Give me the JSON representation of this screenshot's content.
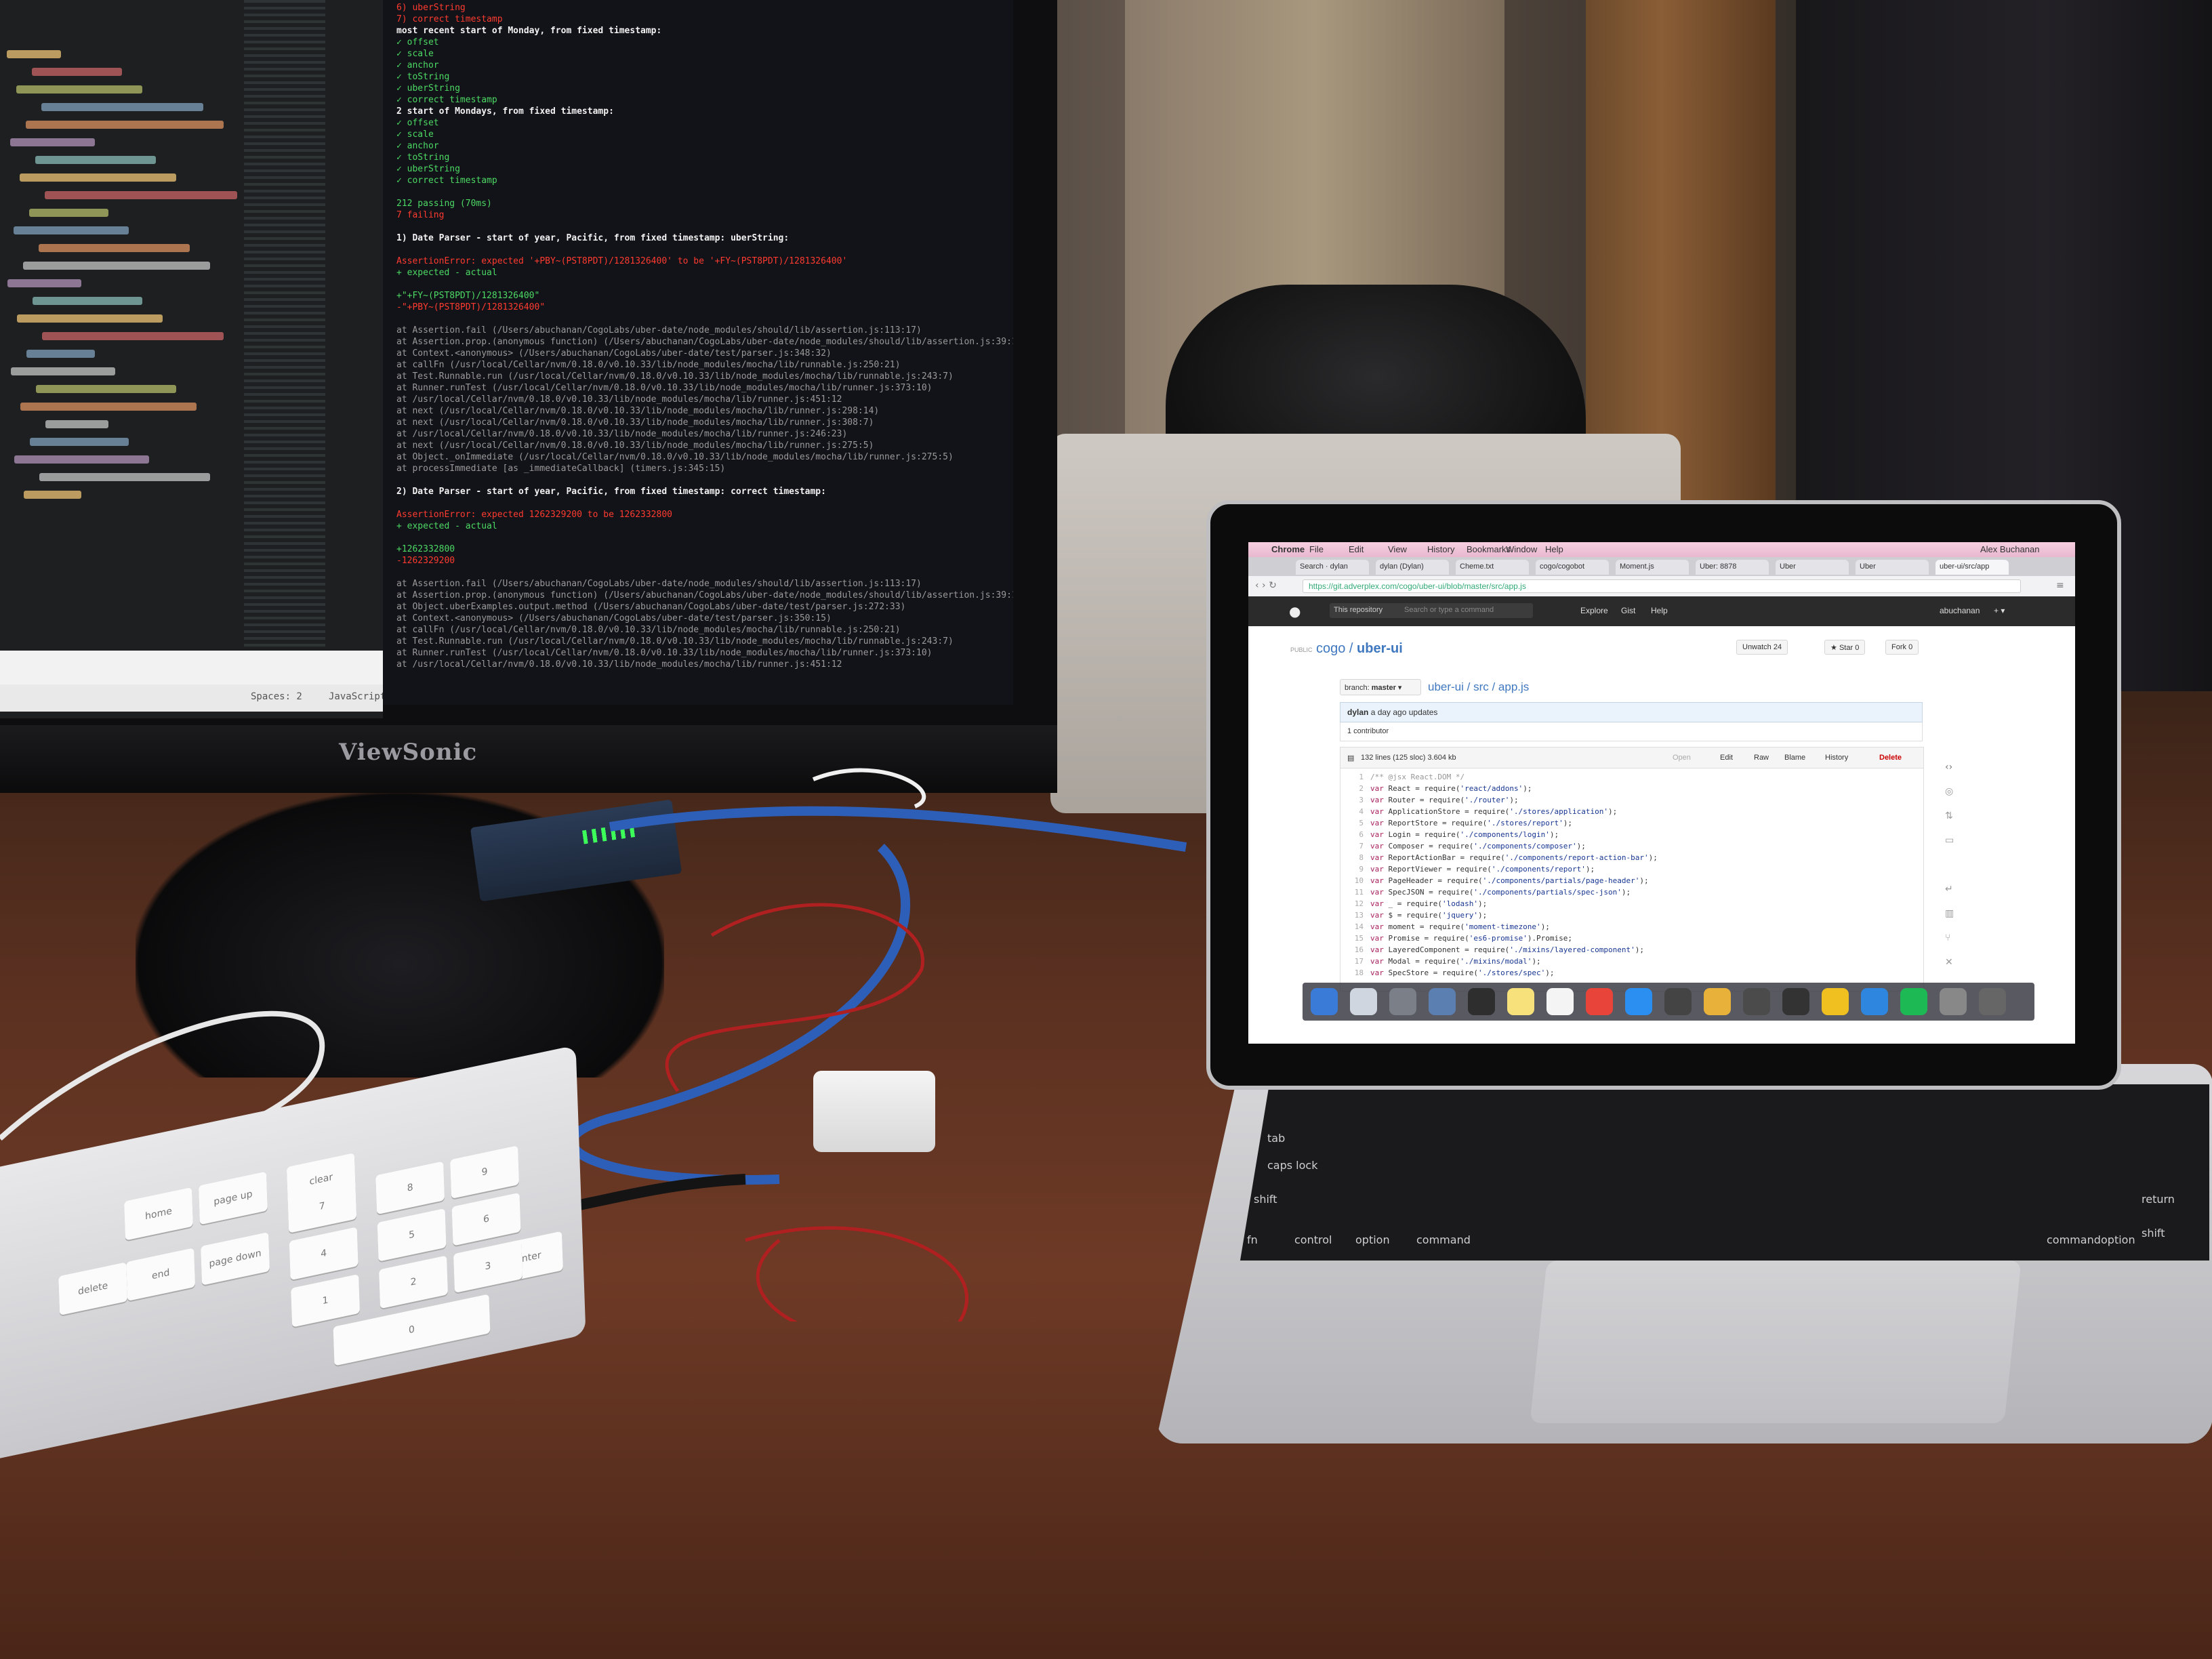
{
  "monitor": {
    "brand": "ViewSonic",
    "editor": {
      "status_left": "Spaces: 2",
      "status_right": "JavaScript",
      "line_colors": [
        "#f0c674",
        "#cc6666",
        "#b5bd68",
        "#81a2be",
        "#de935f",
        "#b294bb",
        "#8abeb7",
        "#f0c674",
        "#cc6666",
        "#b5bd68",
        "#81a2be",
        "#de935f",
        "#c5c8c6",
        "#b294bb",
        "#8abeb7",
        "#f0c674",
        "#cc6666",
        "#81a2be",
        "#c5c8c6",
        "#b5bd68",
        "#de935f",
        "#c5c8c6",
        "#81a2be",
        "#b294bb",
        "#c5c8c6",
        "#f0c674"
      ]
    },
    "terminal": {
      "lines": [
        {
          "text": "6) uberString",
          "style": "red"
        },
        {
          "text": "7) correct timestamp",
          "style": "red"
        },
        {
          "text": "most recent start of Monday, from fixed timestamp:",
          "style": "white"
        },
        {
          "text": "  ✓ offset",
          "style": "green"
        },
        {
          "text": "  ✓ scale",
          "style": "green"
        },
        {
          "text": "  ✓ anchor",
          "style": "green"
        },
        {
          "text": "  ✓ toString",
          "style": "green"
        },
        {
          "text": "  ✓ uberString",
          "style": "green"
        },
        {
          "text": "  ✓ correct timestamp",
          "style": "green"
        },
        {
          "text": "2 start of Mondays, from fixed timestamp:",
          "style": "white"
        },
        {
          "text": "  ✓ offset",
          "style": "green"
        },
        {
          "text": "  ✓ scale",
          "style": "green"
        },
        {
          "text": "  ✓ anchor",
          "style": "green"
        },
        {
          "text": "  ✓ toString",
          "style": "green"
        },
        {
          "text": "  ✓ uberString",
          "style": "green"
        },
        {
          "text": "  ✓ correct timestamp",
          "style": "green"
        },
        {
          "text": "",
          "style": "gray"
        },
        {
          "text": "212 passing (70ms)",
          "style": "green"
        },
        {
          "text": "7 failing",
          "style": "red"
        },
        {
          "text": "",
          "style": "gray"
        },
        {
          "text": "1) Date Parser - start of year, Pacific, from fixed timestamp: uberString:",
          "style": "white"
        },
        {
          "text": "",
          "style": "gray"
        },
        {
          "text": "   AssertionError: expected '+PBY~(PST8PDT)/1281326400' to be '+FY~(PST8PDT)/1281326400'",
          "style": "red"
        },
        {
          "text": "   + expected - actual",
          "style": "green"
        },
        {
          "text": "",
          "style": "gray"
        },
        {
          "text": "   +\"+FY~(PST8PDT)/1281326400\"",
          "style": "green"
        },
        {
          "text": "   -\"+PBY~(PST8PDT)/1281326400\"",
          "style": "red"
        },
        {
          "text": "",
          "style": "gray"
        },
        {
          "text": "   at Assertion.fail (/Users/abuchanan/CogoLabs/uber-date/node_modules/should/lib/assertion.js:113:17)",
          "style": "gray"
        },
        {
          "text": "   at Assertion.prop.(anonymous function) (/Users/abuchanan/CogoLabs/uber-date/node_modules/should/lib/assertion.js:39:14)",
          "style": "gray"
        },
        {
          "text": "   at Context.<anonymous> (/Users/abuchanan/CogoLabs/uber-date/test/parser.js:348:32)",
          "style": "gray"
        },
        {
          "text": "   at callFn (/usr/local/Cellar/nvm/0.18.0/v0.10.33/lib/node_modules/mocha/lib/runnable.js:250:21)",
          "style": "gray"
        },
        {
          "text": "   at Test.Runnable.run (/usr/local/Cellar/nvm/0.18.0/v0.10.33/lib/node_modules/mocha/lib/runnable.js:243:7)",
          "style": "gray"
        },
        {
          "text": "   at Runner.runTest (/usr/local/Cellar/nvm/0.18.0/v0.10.33/lib/node_modules/mocha/lib/runner.js:373:10)",
          "style": "gray"
        },
        {
          "text": "   at /usr/local/Cellar/nvm/0.18.0/v0.10.33/lib/node_modules/mocha/lib/runner.js:451:12",
          "style": "gray"
        },
        {
          "text": "   at next (/usr/local/Cellar/nvm/0.18.0/v0.10.33/lib/node_modules/mocha/lib/runner.js:298:14)",
          "style": "gray"
        },
        {
          "text": "   at next (/usr/local/Cellar/nvm/0.18.0/v0.10.33/lib/node_modules/mocha/lib/runner.js:308:7)",
          "style": "gray"
        },
        {
          "text": "   at /usr/local/Cellar/nvm/0.18.0/v0.10.33/lib/node_modules/mocha/lib/runner.js:246:23)",
          "style": "gray"
        },
        {
          "text": "   at next (/usr/local/Cellar/nvm/0.18.0/v0.10.33/lib/node_modules/mocha/lib/runner.js:275:5)",
          "style": "gray"
        },
        {
          "text": "   at Object._onImmediate (/usr/local/Cellar/nvm/0.18.0/v0.10.33/lib/node_modules/mocha/lib/runner.js:275:5)",
          "style": "gray"
        },
        {
          "text": "   at processImmediate [as _immediateCallback] (timers.js:345:15)",
          "style": "gray"
        },
        {
          "text": "",
          "style": "gray"
        },
        {
          "text": "2) Date Parser - start of year, Pacific, from fixed timestamp: correct timestamp:",
          "style": "white"
        },
        {
          "text": "",
          "style": "gray"
        },
        {
          "text": "   AssertionError: expected 1262329200 to be 1262332800",
          "style": "red"
        },
        {
          "text": "   + expected - actual",
          "style": "green"
        },
        {
          "text": "",
          "style": "gray"
        },
        {
          "text": "   +1262332800",
          "style": "green"
        },
        {
          "text": "   -1262329200",
          "style": "red"
        },
        {
          "text": "",
          "style": "gray"
        },
        {
          "text": "   at Assertion.fail (/Users/abuchanan/CogoLabs/uber-date/node_modules/should/lib/assertion.js:113:17)",
          "style": "gray"
        },
        {
          "text": "   at Assertion.prop.(anonymous function) (/Users/abuchanan/CogoLabs/uber-date/node_modules/should/lib/assertion.js:39:14)",
          "style": "gray"
        },
        {
          "text": "   at Object.uberExamples.output.method (/Users/abuchanan/CogoLabs/uber-date/test/parser.js:272:33)",
          "style": "gray"
        },
        {
          "text": "   at Context.<anonymous> (/Users/abuchanan/CogoLabs/uber-date/test/parser.js:350:15)",
          "style": "gray"
        },
        {
          "text": "   at callFn (/usr/local/Cellar/nvm/0.18.0/v0.10.33/lib/node_modules/mocha/lib/runnable.js:250:21)",
          "style": "gray"
        },
        {
          "text": "   at Test.Runnable.run (/usr/local/Cellar/nvm/0.18.0/v0.10.33/lib/node_modules/mocha/lib/runnable.js:243:7)",
          "style": "gray"
        },
        {
          "text": "   at Runner.runTest (/usr/local/Cellar/nvm/0.18.0/v0.10.33/lib/node_modules/mocha/lib/runner.js:373:10)",
          "style": "gray"
        },
        {
          "text": "   at /usr/local/Cellar/nvm/0.18.0/v0.10.33/lib/node_modules/mocha/lib/runner.js:451:12",
          "style": "gray"
        }
      ]
    }
  },
  "laptop": {
    "menubar": {
      "app": "Chrome",
      "items": [
        "File",
        "Edit",
        "View",
        "History",
        "Bookmarks",
        "Window",
        "Help"
      ],
      "user": "Alex Buchanan"
    },
    "tabs": [
      "Search · dylan",
      "dylan (Dylan)",
      "Cheme.txt",
      "cogo/cogobot",
      "Moment.js",
      "Uber: 8878",
      "Uber",
      "Uber",
      "uber-ui/src/app"
    ],
    "url": "https://git.adverplex.com/cogo/uber-ui/blob/master/src/app.js",
    "github": {
      "header": {
        "this_repository": "This repository",
        "search_placeholder": "Search or type a command",
        "nav": [
          "Explore",
          "Gist",
          "Help"
        ],
        "username": "abuchanan"
      },
      "visibility": "PUBLIC",
      "repo_owner": "cogo",
      "repo_sep": " / ",
      "repo_name": "uber-ui",
      "unwatch": "Unwatch",
      "unwatch_count": "24",
      "star": "Star",
      "star_count": "0",
      "fork": "Fork",
      "fork_count": "0",
      "branch_label": "branch:",
      "branch": "master",
      "breadcrumb": "uber-ui / src / app.js",
      "commit_author": "dylan",
      "commit_msg": "a day ago updates",
      "contributors": "1 contributor",
      "file_info": "132 lines (125 sloc)   3.604 kb",
      "file_buttons": [
        "Open",
        "Edit",
        "Raw",
        "Blame",
        "History",
        "Delete"
      ],
      "code_lines": [
        {
          "n": "1",
          "parts": [
            {
              "c": "cmt",
              "t": "/** @jsx React.DOM */"
            }
          ]
        },
        {
          "n": "2",
          "parts": [
            {
              "c": "kw",
              "t": "var "
            },
            {
              "c": "",
              "t": "React = require("
            },
            {
              "c": "str",
              "t": "'react/addons'"
            },
            {
              "c": "",
              "t": ");"
            }
          ]
        },
        {
          "n": "3",
          "parts": [
            {
              "c": "kw",
              "t": "var "
            },
            {
              "c": "",
              "t": "Router = require("
            },
            {
              "c": "str",
              "t": "'./router'"
            },
            {
              "c": "",
              "t": ");"
            }
          ]
        },
        {
          "n": "4",
          "parts": [
            {
              "c": "kw",
              "t": "var "
            },
            {
              "c": "",
              "t": "ApplicationStore = require("
            },
            {
              "c": "str",
              "t": "'./stores/application'"
            },
            {
              "c": "",
              "t": ");"
            }
          ]
        },
        {
          "n": "5",
          "parts": [
            {
              "c": "kw",
              "t": "var "
            },
            {
              "c": "",
              "t": "ReportStore = require("
            },
            {
              "c": "str",
              "t": "'./stores/report'"
            },
            {
              "c": "",
              "t": ");"
            }
          ]
        },
        {
          "n": "6",
          "parts": [
            {
              "c": "kw",
              "t": "var "
            },
            {
              "c": "",
              "t": "Login = require("
            },
            {
              "c": "str",
              "t": "'./components/login'"
            },
            {
              "c": "",
              "t": ");"
            }
          ]
        },
        {
          "n": "7",
          "parts": [
            {
              "c": "kw",
              "t": "var "
            },
            {
              "c": "",
              "t": "Composer = require("
            },
            {
              "c": "str",
              "t": "'./components/composer'"
            },
            {
              "c": "",
              "t": ");"
            }
          ]
        },
        {
          "n": "8",
          "parts": [
            {
              "c": "kw",
              "t": "var "
            },
            {
              "c": "",
              "t": "ReportActionBar = require("
            },
            {
              "c": "str",
              "t": "'./components/report-action-bar'"
            },
            {
              "c": "",
              "t": ");"
            }
          ]
        },
        {
          "n": "9",
          "parts": [
            {
              "c": "kw",
              "t": "var "
            },
            {
              "c": "",
              "t": "ReportViewer = require("
            },
            {
              "c": "str",
              "t": "'./components/report'"
            },
            {
              "c": "",
              "t": ");"
            }
          ]
        },
        {
          "n": "10",
          "parts": [
            {
              "c": "kw",
              "t": "var "
            },
            {
              "c": "",
              "t": "PageHeader = require("
            },
            {
              "c": "str",
              "t": "'./components/partials/page-header'"
            },
            {
              "c": "",
              "t": ");"
            }
          ]
        },
        {
          "n": "11",
          "parts": [
            {
              "c": "kw",
              "t": "var "
            },
            {
              "c": "",
              "t": "SpecJSON = require("
            },
            {
              "c": "str",
              "t": "'./components/partials/spec-json'"
            },
            {
              "c": "",
              "t": ");"
            }
          ]
        },
        {
          "n": "12",
          "parts": [
            {
              "c": "kw",
              "t": "var "
            },
            {
              "c": "",
              "t": "_ = require("
            },
            {
              "c": "str",
              "t": "'lodash'"
            },
            {
              "c": "",
              "t": ");"
            }
          ]
        },
        {
          "n": "13",
          "parts": [
            {
              "c": "kw",
              "t": "var "
            },
            {
              "c": "",
              "t": "$ = require("
            },
            {
              "c": "str",
              "t": "'jquery'"
            },
            {
              "c": "",
              "t": ");"
            }
          ]
        },
        {
          "n": "14",
          "parts": [
            {
              "c": "kw",
              "t": "var "
            },
            {
              "c": "",
              "t": "moment = require("
            },
            {
              "c": "str",
              "t": "'moment-timezone'"
            },
            {
              "c": "",
              "t": ");"
            }
          ]
        },
        {
          "n": "15",
          "parts": [
            {
              "c": "kw",
              "t": "var "
            },
            {
              "c": "",
              "t": "Promise = require("
            },
            {
              "c": "str",
              "t": "'es6-promise'"
            },
            {
              "c": "",
              "t": ").Promise;"
            }
          ]
        },
        {
          "n": "16",
          "parts": [
            {
              "c": "kw",
              "t": "var "
            },
            {
              "c": "",
              "t": "LayeredComponent = require("
            },
            {
              "c": "str",
              "t": "'./mixins/layered-component'"
            },
            {
              "c": "",
              "t": ");"
            }
          ]
        },
        {
          "n": "17",
          "parts": [
            {
              "c": "kw",
              "t": "var "
            },
            {
              "c": "",
              "t": "Modal = require("
            },
            {
              "c": "str",
              "t": "'./mixins/modal'"
            },
            {
              "c": "",
              "t": ");"
            }
          ]
        },
        {
          "n": "18",
          "parts": [
            {
              "c": "kw",
              "t": "var "
            },
            {
              "c": "",
              "t": "SpecStore = require("
            },
            {
              "c": "str",
              "t": "'./stores/spec'"
            },
            {
              "c": "",
              "t": ");"
            }
          ]
        }
      ]
    },
    "dock_colors": [
      "#3b7bd8",
      "#d0d6e0",
      "#7a7f88",
      "#5a7fb0",
      "#2e2e2e",
      "#f7e17a",
      "#f4f4f4",
      "#e8443a",
      "#2a8ff0",
      "#444",
      "#e8b23a",
      "#4b4b4b",
      "#333",
      "#f0c020",
      "#2e86de",
      "#1db954",
      "#888",
      "#666"
    ],
    "keyboard_labels": [
      "tab",
      "caps lock",
      "shift",
      "fn",
      "control",
      "option",
      "command",
      "return",
      "shift",
      "option",
      "command"
    ]
  },
  "desk_keyboard": {
    "labels": [
      "home",
      "page up",
      "delete",
      "end",
      "page down",
      "clear",
      "enter",
      "0",
      "1",
      "2",
      "3",
      "4",
      "5",
      "6",
      "7",
      "8",
      "9"
    ]
  }
}
